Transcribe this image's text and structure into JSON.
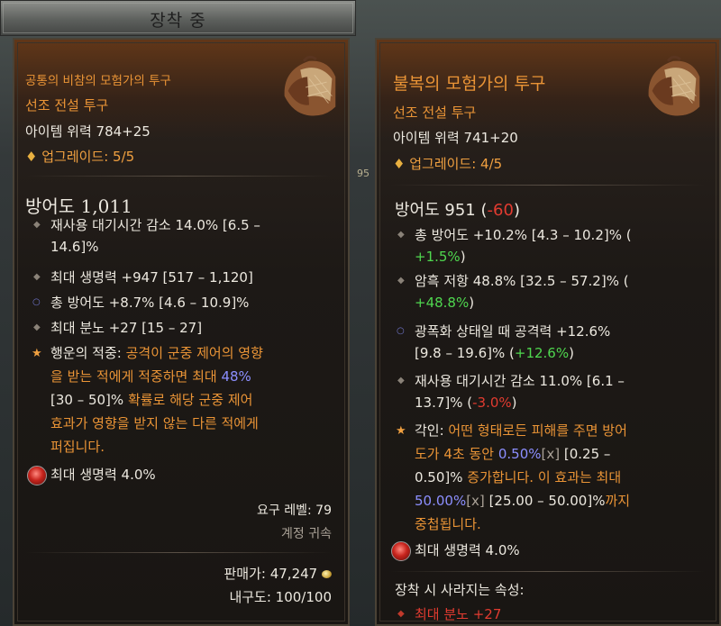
{
  "header": {
    "title": "장착 중"
  },
  "left": {
    "name": "공통의 비참의 모험가의 투구",
    "type": "선조 전설 투구",
    "power": "아이템 위력 784+25",
    "upgrade": "업그레이드: 5/5",
    "armor": "방어도 1,011",
    "affixes": [
      {
        "l1": "재사용 대기시간 감소 14.0% [6.5 –",
        "l2": "14.6]%"
      },
      {
        "l1": "최대 생명력 +947 [517 – 1,120]"
      },
      {
        "l1": "총 방어도 +8.7% [4.6 – 10.9]%"
      },
      {
        "l1": "최대 분노 +27 [15 – 27]"
      }
    ],
    "aspect": {
      "name": "행운의 적중:",
      "l1rest": " 공격이 군중 제어의 영향",
      "l2a": "을 받는 적에게 적중하면 최대 ",
      "l2val": "48%",
      "l3range": "[30 – 50]%",
      "l3rest": " 확률로 해당 군중 제어",
      "l4": "효과가 영향을 받지 않는 다른 적에게",
      "l5": "퍼집니다."
    },
    "gem": "최대 생명력 4.0%",
    "req_level": "요구 레벨: 79",
    "account_bound": "계정 귀속",
    "sell_value": "판매가: 47,247",
    "durability": "내구도: 100/100"
  },
  "right": {
    "name": "불복의 모험가의 투구",
    "type": "선조 전설 투구",
    "power": "아이템 위력 741+20",
    "upgrade": "업그레이드: 4/5",
    "armor": "방어도 951",
    "armor_diff": "-60",
    "affixes": [
      {
        "l1": "총 방어도 +10.2% [4.3 – 10.2]% (",
        "diff": "+1.5%"
      },
      {
        "l1": "암흑 저항 48.8% [32.5 – 57.2]% (",
        "diff": "+48.8%"
      },
      {
        "l1": "광폭화 상태일 때 공격력 +12.6%",
        "l2": "[9.8 – 19.6]% (",
        "diff": "+12.6%"
      },
      {
        "l1": "재사용 대기시간 감소 11.0% [6.1 –",
        "l2": "13.7]% (",
        "diff": "-3.0%"
      }
    ],
    "aspect": {
      "name": "각인:",
      "l1rest": " 어떤 형태로든 피해를 주면 방어",
      "l2a": "도가 4초 동안 ",
      "l2val": "0.50%",
      "l2x": "[x]",
      "l2range": " [0.25 –",
      "l3range": "0.50]%",
      "l3rest": " 증가합니다. 이 효과는 최대",
      "l4val": "50.00%",
      "l4x": "[x]",
      "l4range": " [25.00 – 50.00]%",
      "l4rest": "까지",
      "l5": "중첩됩니다."
    },
    "gem": "최대 생명력 4.0%",
    "lost_title": "장착 시 사라지는 속성:",
    "lost": [
      {
        "label": "최대 분노 +27"
      }
    ]
  },
  "background": {
    "mark": "95"
  }
}
